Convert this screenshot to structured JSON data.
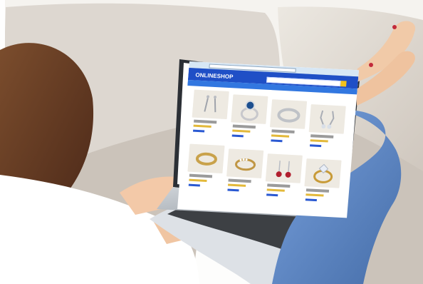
{
  "website": {
    "logo": "ONLINESHOP"
  },
  "colors": {
    "accent_blue": "#1f4fc6",
    "skin": "#f3c9a8",
    "jeans": "#5f86c8",
    "sofa": "#d8d1c9"
  }
}
